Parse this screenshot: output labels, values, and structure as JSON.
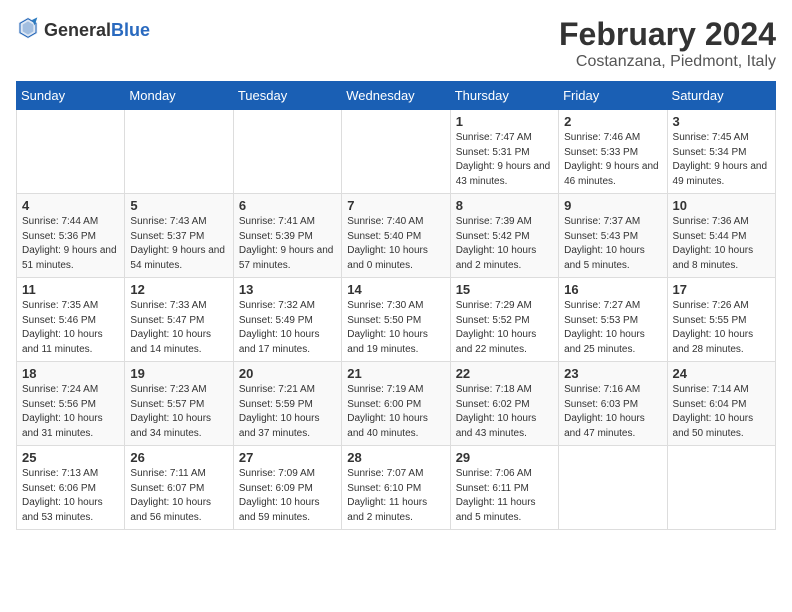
{
  "logo": {
    "text_general": "General",
    "text_blue": "Blue"
  },
  "title": {
    "month": "February 2024",
    "location": "Costanzana, Piedmont, Italy"
  },
  "headers": [
    "Sunday",
    "Monday",
    "Tuesday",
    "Wednesday",
    "Thursday",
    "Friday",
    "Saturday"
  ],
  "weeks": [
    [
      {
        "day": "",
        "info": ""
      },
      {
        "day": "",
        "info": ""
      },
      {
        "day": "",
        "info": ""
      },
      {
        "day": "",
        "info": ""
      },
      {
        "day": "1",
        "info": "Sunrise: 7:47 AM\nSunset: 5:31 PM\nDaylight: 9 hours\nand 43 minutes."
      },
      {
        "day": "2",
        "info": "Sunrise: 7:46 AM\nSunset: 5:33 PM\nDaylight: 9 hours\nand 46 minutes."
      },
      {
        "day": "3",
        "info": "Sunrise: 7:45 AM\nSunset: 5:34 PM\nDaylight: 9 hours\nand 49 minutes."
      }
    ],
    [
      {
        "day": "4",
        "info": "Sunrise: 7:44 AM\nSunset: 5:36 PM\nDaylight: 9 hours\nand 51 minutes."
      },
      {
        "day": "5",
        "info": "Sunrise: 7:43 AM\nSunset: 5:37 PM\nDaylight: 9 hours\nand 54 minutes."
      },
      {
        "day": "6",
        "info": "Sunrise: 7:41 AM\nSunset: 5:39 PM\nDaylight: 9 hours\nand 57 minutes."
      },
      {
        "day": "7",
        "info": "Sunrise: 7:40 AM\nSunset: 5:40 PM\nDaylight: 10 hours\nand 0 minutes."
      },
      {
        "day": "8",
        "info": "Sunrise: 7:39 AM\nSunset: 5:42 PM\nDaylight: 10 hours\nand 2 minutes."
      },
      {
        "day": "9",
        "info": "Sunrise: 7:37 AM\nSunset: 5:43 PM\nDaylight: 10 hours\nand 5 minutes."
      },
      {
        "day": "10",
        "info": "Sunrise: 7:36 AM\nSunset: 5:44 PM\nDaylight: 10 hours\nand 8 minutes."
      }
    ],
    [
      {
        "day": "11",
        "info": "Sunrise: 7:35 AM\nSunset: 5:46 PM\nDaylight: 10 hours\nand 11 minutes."
      },
      {
        "day": "12",
        "info": "Sunrise: 7:33 AM\nSunset: 5:47 PM\nDaylight: 10 hours\nand 14 minutes."
      },
      {
        "day": "13",
        "info": "Sunrise: 7:32 AM\nSunset: 5:49 PM\nDaylight: 10 hours\nand 17 minutes."
      },
      {
        "day": "14",
        "info": "Sunrise: 7:30 AM\nSunset: 5:50 PM\nDaylight: 10 hours\nand 19 minutes."
      },
      {
        "day": "15",
        "info": "Sunrise: 7:29 AM\nSunset: 5:52 PM\nDaylight: 10 hours\nand 22 minutes."
      },
      {
        "day": "16",
        "info": "Sunrise: 7:27 AM\nSunset: 5:53 PM\nDaylight: 10 hours\nand 25 minutes."
      },
      {
        "day": "17",
        "info": "Sunrise: 7:26 AM\nSunset: 5:55 PM\nDaylight: 10 hours\nand 28 minutes."
      }
    ],
    [
      {
        "day": "18",
        "info": "Sunrise: 7:24 AM\nSunset: 5:56 PM\nDaylight: 10 hours\nand 31 minutes."
      },
      {
        "day": "19",
        "info": "Sunrise: 7:23 AM\nSunset: 5:57 PM\nDaylight: 10 hours\nand 34 minutes."
      },
      {
        "day": "20",
        "info": "Sunrise: 7:21 AM\nSunset: 5:59 PM\nDaylight: 10 hours\nand 37 minutes."
      },
      {
        "day": "21",
        "info": "Sunrise: 7:19 AM\nSunset: 6:00 PM\nDaylight: 10 hours\nand 40 minutes."
      },
      {
        "day": "22",
        "info": "Sunrise: 7:18 AM\nSunset: 6:02 PM\nDaylight: 10 hours\nand 43 minutes."
      },
      {
        "day": "23",
        "info": "Sunrise: 7:16 AM\nSunset: 6:03 PM\nDaylight: 10 hours\nand 47 minutes."
      },
      {
        "day": "24",
        "info": "Sunrise: 7:14 AM\nSunset: 6:04 PM\nDaylight: 10 hours\nand 50 minutes."
      }
    ],
    [
      {
        "day": "25",
        "info": "Sunrise: 7:13 AM\nSunset: 6:06 PM\nDaylight: 10 hours\nand 53 minutes."
      },
      {
        "day": "26",
        "info": "Sunrise: 7:11 AM\nSunset: 6:07 PM\nDaylight: 10 hours\nand 56 minutes."
      },
      {
        "day": "27",
        "info": "Sunrise: 7:09 AM\nSunset: 6:09 PM\nDaylight: 10 hours\nand 59 minutes."
      },
      {
        "day": "28",
        "info": "Sunrise: 7:07 AM\nSunset: 6:10 PM\nDaylight: 11 hours\nand 2 minutes."
      },
      {
        "day": "29",
        "info": "Sunrise: 7:06 AM\nSunset: 6:11 PM\nDaylight: 11 hours\nand 5 minutes."
      },
      {
        "day": "",
        "info": ""
      },
      {
        "day": "",
        "info": ""
      }
    ]
  ]
}
